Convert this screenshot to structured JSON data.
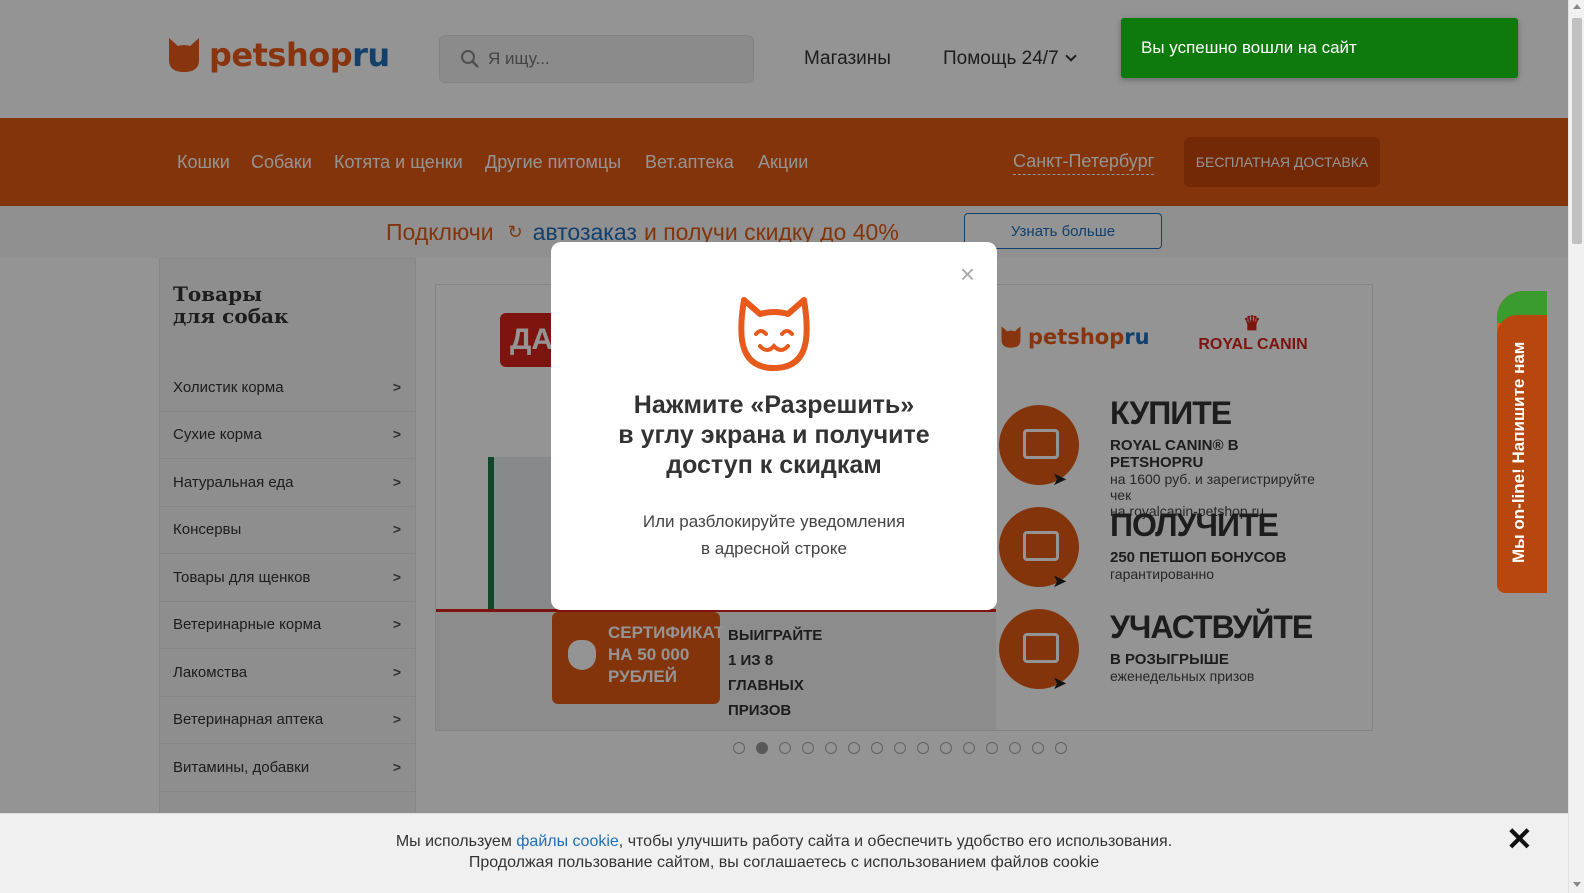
{
  "header": {
    "logo": {
      "main": "petshop",
      "accent": "ru"
    },
    "search": {
      "placeholder": "Я ищу..."
    },
    "links": {
      "stores": "Магазины",
      "help": "Помощь 24/7"
    }
  },
  "nav": {
    "items": [
      "Кошки",
      "Собаки",
      "Котята и щенки",
      "Другие питомцы",
      "Вет.аптека",
      "Акции"
    ],
    "city": "Санкт-Петербург",
    "delivery": "БЕСПЛАТНАЯ ДОСТАВКА"
  },
  "promo": {
    "part1": "Подключи",
    "part2": "автозаказ",
    "part3": "и получи скидку до 40%",
    "button": "Узнать больше"
  },
  "sidebar": {
    "title": {
      "line1": "Товары",
      "line2": "для собак"
    },
    "items": [
      {
        "label": "Холистик корма"
      },
      {
        "label": "Сухие корма"
      },
      {
        "label": "Натуральная еда"
      },
      {
        "label": "Консервы"
      },
      {
        "label": "Товары для щенков"
      },
      {
        "label": "Ветеринарные корма"
      },
      {
        "label": "Лакомства"
      },
      {
        "label": "Ветеринарная аптека"
      },
      {
        "label": "Витамины, добавки"
      }
    ],
    "arrow": ">"
  },
  "banner": {
    "red_badge": "ДА",
    "logo": {
      "main": "petshop",
      "accent": "ru"
    },
    "brand": "ROYAL CANIN",
    "steps": [
      {
        "heading": "КУПИТЕ",
        "sub1": "ROYAL CANIN® В PETSHOPRU",
        "sub2": "на 1600 руб. и зарегистрируйте чек",
        "sub3": "на royalcanin-petshop.ru"
      },
      {
        "heading": "ПОЛУЧИТЕ",
        "sub1": "250 ПЕТШОП БОНУСОВ",
        "sub2": "гарантированно",
        "sub3": ""
      },
      {
        "heading": "УЧАСТВУЙТЕ",
        "sub1": "В РОЗЫГРЫШЕ",
        "sub2": "еженедельных призов",
        "sub3": ""
      }
    ],
    "certificate": {
      "line1": "СЕРТИФИКАТ",
      "line2": "НА 50 000",
      "line3": "РУБЛЕЙ"
    },
    "win": {
      "line1": "ВЫИГРАЙТЕ",
      "line2": "1 ИЗ 8",
      "line3": "ГЛАВНЫХ ПРИЗОВ"
    },
    "dots_total": 15,
    "active_dot": 2
  },
  "toast": {
    "text": "Вы успешно вошли на сайт",
    "color": "#0e7a0d"
  },
  "modal": {
    "close": "×",
    "title": {
      "line1": "Нажмите «Разрешить»",
      "line2": "в углу экрана и получите",
      "line3": "доступ к скидкам"
    },
    "subtitle": {
      "line1": "Или разблокируйте уведомления",
      "line2": "в адресной строке"
    }
  },
  "chat": {
    "text": "Мы on-line! Напишите нам"
  },
  "cookie": {
    "text1": "Мы используем",
    "link": "файлы cookie",
    "text2": ", чтобы улучшить работу сайта и обеспечить удобство его использования.",
    "line2": "Продолжая пользование сайтом, вы соглашаетесь с использованием файлов cookie",
    "close": "✕"
  },
  "colors": {
    "brand_orange": "#e25a14",
    "brand_blue": "#1f6fb8",
    "success_green": "#0e7a0d"
  }
}
